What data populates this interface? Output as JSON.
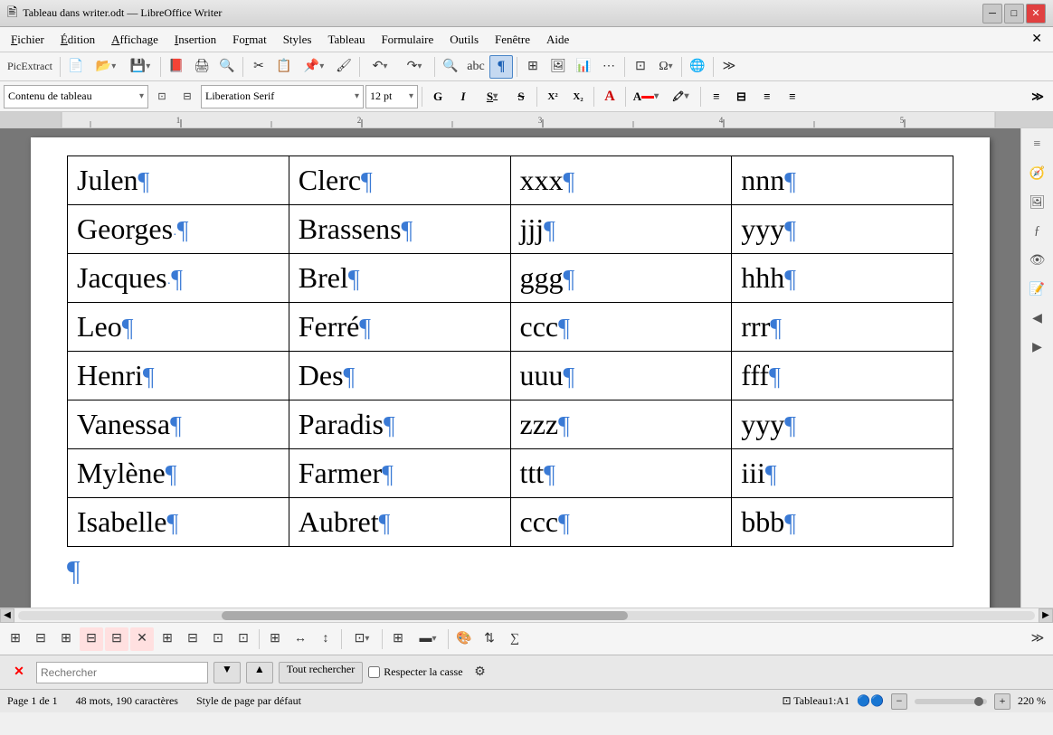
{
  "titlebar": {
    "icon": "✦",
    "title": "Tableau dans writer.odt — LibreOffice Writer",
    "minimize": "─",
    "maximize": "□",
    "close": "✕"
  },
  "menu": {
    "items": [
      {
        "label": "Fichier",
        "underline_index": 0
      },
      {
        "label": "Édition",
        "underline_index": 0
      },
      {
        "label": "Affichage",
        "underline_index": 0
      },
      {
        "label": "Insertion",
        "underline_index": 0
      },
      {
        "label": "Format",
        "underline_index": 0
      },
      {
        "label": "Styles",
        "underline_index": 0
      },
      {
        "label": "Tableau",
        "underline_index": 0
      },
      {
        "label": "Formulaire",
        "underline_index": 0
      },
      {
        "label": "Outils",
        "underline_index": 0
      },
      {
        "label": "Fenêtre",
        "underline_index": 0
      },
      {
        "label": "Aide",
        "underline_index": 0
      }
    ]
  },
  "toolbar1": {
    "picextract_label": "PicExtract"
  },
  "toolbar2": {
    "style": "Contenu de tableau",
    "font": "Liberation Serif",
    "size": "12 pt",
    "bold": "G",
    "italic": "I",
    "underline": "S",
    "strikethrough": "S"
  },
  "table": {
    "rows": [
      {
        "col1": "Julen",
        "col2": "Clerc",
        "col3": "xxx",
        "col4": "nnn"
      },
      {
        "col1": "Georges",
        "col2": "Brassens",
        "col3": "jjj",
        "col4": "yyy"
      },
      {
        "col1": "Jacques",
        "col2": "Brel",
        "col3": "ggg",
        "col4": "hhh"
      },
      {
        "col1": "Leo",
        "col2": "Ferré",
        "col3": "ccc",
        "col4": "rrr"
      },
      {
        "col1": "Henri",
        "col2": "Des",
        "col3": "uuu",
        "col4": "fff"
      },
      {
        "col1": "Vanessa",
        "col2": "Paradis",
        "col3": "zzz",
        "col4": "yyy"
      },
      {
        "col1": "Mylène",
        "col2": "Farmer",
        "col3": "ttt",
        "col4": "iii"
      },
      {
        "col1": "Isabelle",
        "col2": "Aubret",
        "col3": "ccc",
        "col4": "bbb"
      }
    ]
  },
  "find": {
    "placeholder": "Rechercher",
    "prev_label": "◄",
    "next_label": "►",
    "find_all_label": "Tout rechercher",
    "match_case_label": "Respecter la casse",
    "options_icon": "⚙"
  },
  "statusbar": {
    "page": "Page 1 de 1",
    "words": "48 mots, 190 caractères",
    "style": "Style de page par défaut",
    "cell": "Tableau1:A1",
    "zoom": "220 %"
  }
}
